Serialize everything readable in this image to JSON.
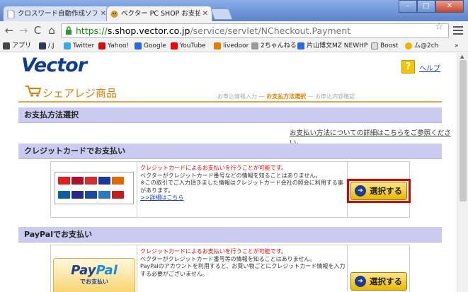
{
  "browser": {
    "tabs": [
      {
        "label": "クロスワード自動作成ソフト『",
        "state": "inactive"
      },
      {
        "label": "ベクター PC SHOP お支払い",
        "state": "active"
      }
    ],
    "url": {
      "scheme": "https://",
      "host": "s.shop.vector.co.jp",
      "path": "/service/servlet/NCheckout.Payment"
    },
    "bookmarks": [
      "アプリ",
      "/.J",
      "Twitter",
      "Yahoo!",
      "Google",
      "YouTube",
      "livedoor",
      "2ちゃんねる",
      "片山博文MZ NEWHP",
      "Boost",
      "ム@2ch"
    ],
    "more": "»"
  },
  "colors": {
    "accent_orange": "#e37c00",
    "section_bar": "#cbcbf2",
    "highlight": "#e00000",
    "logo_blue": "#0e3e8c"
  },
  "header": {
    "logo": "Vector",
    "help_label": "ヘルプ"
  },
  "shop": {
    "title": "シェアレジ商品",
    "steps": {
      "step1": "お申込情報入力",
      "step2": "お支払方法選択",
      "step3": "お申込内容確認"
    }
  },
  "sections": {
    "payment_method": {
      "title": "お支払方法選択",
      "detail_link": "お支払い方法についての詳細はこちらをご参照ください。"
    },
    "credit_card": {
      "title": "クレジットカードでお支払い",
      "line1": "クレジットカードによるお支払いを行うことが可能です。",
      "line2": "ベクターがクレジットカード番号などの情報を知ることはありません。",
      "line3": "※この取引でご入力頂きました情報はクレジットカード会社の照会に利用する事があります。",
      "link": ">>詳細はこちら",
      "button": "選択する"
    },
    "paypal": {
      "title": "PayPalでお支払い",
      "logo_text_1": "Pay",
      "logo_text_2": "Pal",
      "logo_sub": "でお支払い",
      "line1": "クレジットカードによるお支払いを行うことが可能です。",
      "line2": "ベクターがクレジットカード番号等の情報を知ることはありません。",
      "line3": "PayPalのアカウントを利用すると、お買い物ごとにクレジットカード情報を入力する必要がございません。",
      "button": "選択する"
    }
  }
}
